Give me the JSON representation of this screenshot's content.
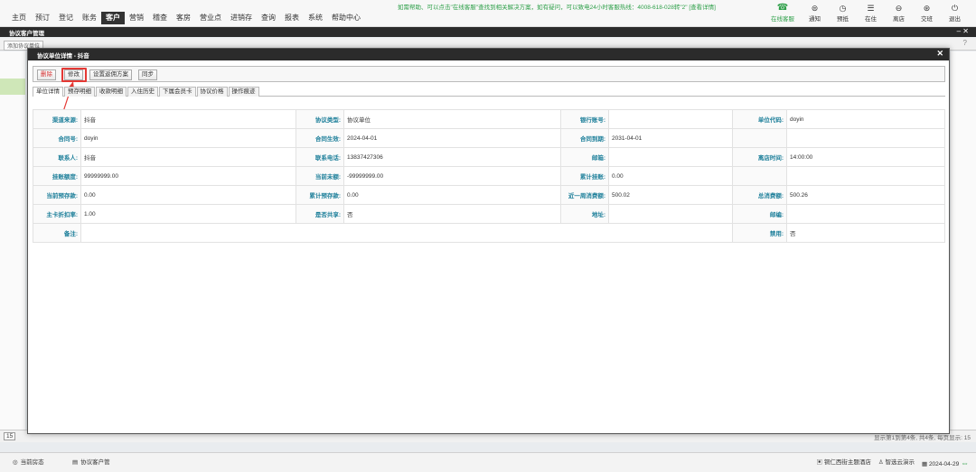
{
  "notice": "如需帮助、可以点击\"在线客服\"查找到相关解决方案，如有疑问，可以致电24小时客服热线：4008-618-028转\"2\" [查看详情]",
  "nav": [
    "主页",
    "预订",
    "登记",
    "账务",
    "客户",
    "营销",
    "稽查",
    "客房",
    "营业点",
    "进销存",
    "查询",
    "报表",
    "系统",
    "帮助中心"
  ],
  "nav_active": "客户",
  "tools": [
    {
      "label": "在线客服",
      "icon": "headset-icon"
    },
    {
      "label": "通知",
      "icon": "bell-icon"
    },
    {
      "label": "预抵",
      "icon": "clock-icon"
    },
    {
      "label": "在住",
      "icon": "bed-icon"
    },
    {
      "label": "离店",
      "icon": "exit-icon"
    },
    {
      "label": "交班",
      "icon": "handover-icon"
    },
    {
      "label": "退出",
      "icon": "power-icon"
    }
  ],
  "window_title": "协议客户管理",
  "bg": {
    "add_button": "添加协议单位",
    "page_size": "15",
    "pager_info": "显示第1到第4条, 共4条, 每页显示: 15"
  },
  "modal": {
    "title": "协议单位详情 - 抖音",
    "buttons": {
      "delete": "删除",
      "edit": "修改",
      "return_plan": "设置返佣方案",
      "sync": "同步"
    },
    "tabs": [
      "单位详情",
      "预存明细",
      "收款明细",
      "入住历史",
      "下属会员卡",
      "协议价格",
      "操作痕迹"
    ],
    "active_tab": "单位详情",
    "rows": [
      [
        [
          "渠道来源:",
          "抖音"
        ],
        [
          "协议类型:",
          "协议单位"
        ],
        [
          "银行账号:",
          ""
        ],
        [
          "单位代码:",
          "doyin"
        ]
      ],
      [
        [
          "合同号:",
          "doyin"
        ],
        [
          "合同生效:",
          "2024-04-01"
        ],
        [
          "合同到期:",
          "2031-04-01"
        ],
        [
          "",
          ""
        ]
      ],
      [
        [
          "联系人:",
          "抖音"
        ],
        [
          "联系电话:",
          "13837427306"
        ],
        [
          "邮箱:",
          ""
        ],
        [
          "离店时间:",
          "14:00:00"
        ]
      ],
      [
        [
          "挂账额度:",
          "99999999.00"
        ],
        [
          "当前未额:",
          "-99999999.00"
        ],
        [
          "累计挂账:",
          "0.00"
        ],
        [
          "",
          ""
        ]
      ],
      [
        [
          "当前预存款:",
          "0.00"
        ],
        [
          "累计预存款:",
          "0.00"
        ],
        [
          "近一周消费额:",
          "500.02"
        ],
        [
          "总消费额:",
          "500.26"
        ]
      ],
      [
        [
          "主卡折扣率:",
          "1.00"
        ],
        [
          "是否共享:",
          "否"
        ],
        [
          "地址:",
          ""
        ],
        [
          "邮编:",
          ""
        ]
      ],
      [
        [
          "备注:",
          ""
        ],
        null,
        null,
        [
          "禁用:",
          "否"
        ]
      ]
    ]
  },
  "status": {
    "tab1": "当前房态",
    "tab2": "协议客户管",
    "hotel": "铜仁西街主题酒店",
    "user": "智选云演示",
    "date": "2024-04-29"
  }
}
